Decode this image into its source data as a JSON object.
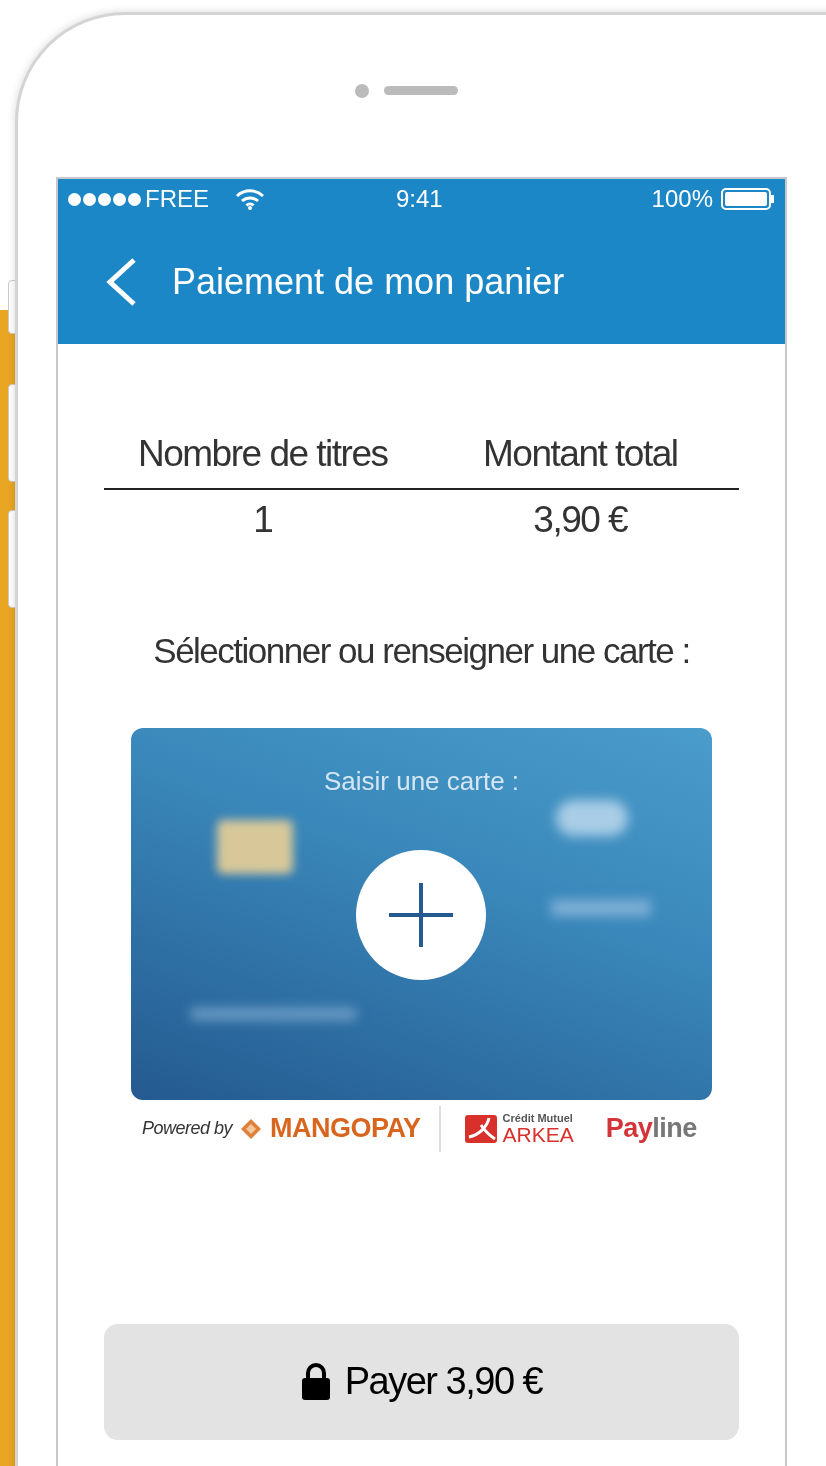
{
  "status_bar": {
    "carrier": "FREE",
    "time": "9:41",
    "battery": "100%"
  },
  "header": {
    "title": "Paiement de mon panier"
  },
  "summary": {
    "columns": [
      {
        "heading": "Nombre de titres",
        "value": "1"
      },
      {
        "heading": "Montant total",
        "value": "3,90 €"
      }
    ]
  },
  "card_prompt": "Sélectionner ou renseigner une carte :",
  "card": {
    "label": "Saisir une carte :"
  },
  "partners": [
    {
      "kind": "mangopay",
      "prefix": "Powered by",
      "name": "MANGOPAY"
    },
    {
      "kind": "arkea",
      "top": "Crédit Mutuel",
      "name": "ARKEA"
    },
    {
      "kind": "payline",
      "name_a": "Pay",
      "name_b": "line"
    }
  ],
  "pay_button": {
    "label": "Payer 3,90 €"
  }
}
